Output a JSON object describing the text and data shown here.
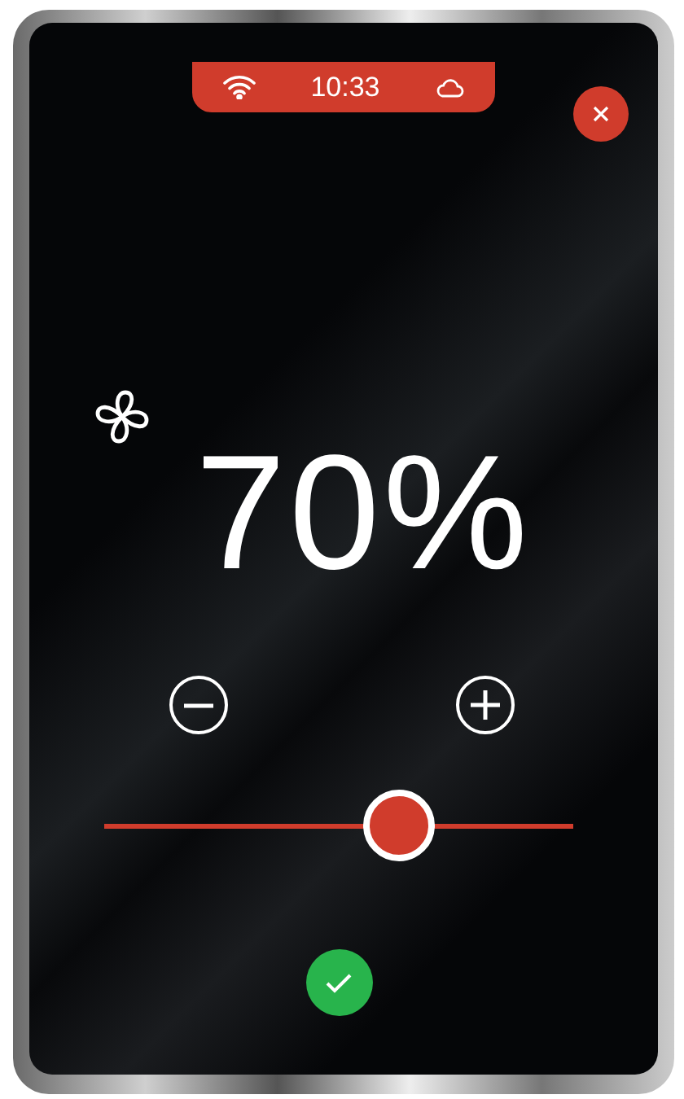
{
  "status_bar": {
    "time": "10:33"
  },
  "fan_speed": {
    "reading": "70%",
    "level": 0.63
  }
}
